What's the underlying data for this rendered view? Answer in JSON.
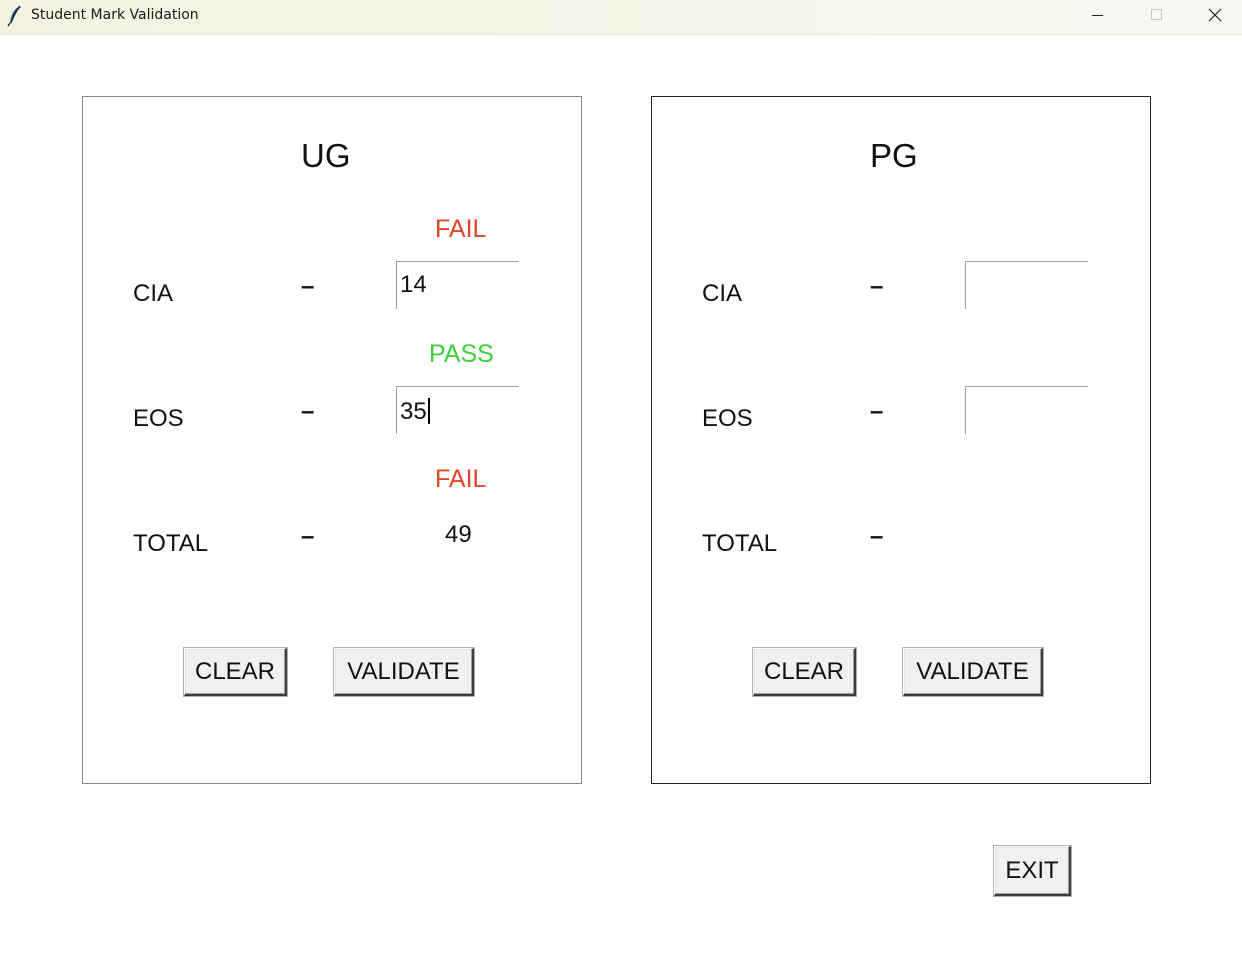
{
  "window": {
    "title": "Student Mark Validation",
    "icon": "feather-icon",
    "controls": [
      "minimize-icon",
      "maximize-icon",
      "close-icon"
    ]
  },
  "ug": {
    "heading": "UG",
    "cia": {
      "label": "CIA",
      "dash": "–",
      "value": "14",
      "status": "FAIL",
      "status_color": "#e0452a"
    },
    "eos": {
      "label": "EOS",
      "dash": "–",
      "value": "35",
      "status": "PASS",
      "status_color": "#3ecf3e"
    },
    "total": {
      "label": "TOTAL",
      "dash": "–",
      "value": "49",
      "status": "FAIL",
      "status_color": "#e0452a"
    },
    "clear_label": "CLEAR",
    "validate_label": "VALIDATE"
  },
  "pg": {
    "heading": "PG",
    "cia": {
      "label": "CIA",
      "dash": "–",
      "value": ""
    },
    "eos": {
      "label": "EOS",
      "dash": "–",
      "value": ""
    },
    "total": {
      "label": "TOTAL",
      "dash": "–",
      "value": ""
    },
    "clear_label": "CLEAR",
    "validate_label": "VALIDATE"
  },
  "exit_label": "EXIT"
}
